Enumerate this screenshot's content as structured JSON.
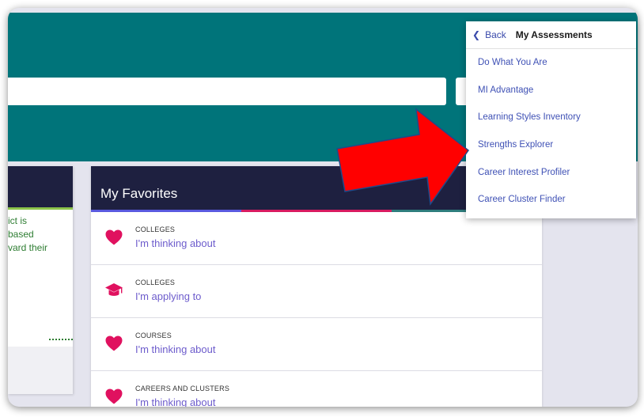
{
  "colors": {
    "teal_header": "#00747a",
    "dark_card_header": "#1e2040",
    "link_purple": "#6d5ccc",
    "dropdown_link": "#3f51b5",
    "heart": "#e0115f",
    "annotation_arrow": "#ff0000",
    "stripe": [
      "#5a5adf",
      "#d81b60",
      "#2e7d7d"
    ]
  },
  "left_card": {
    "text_lines": [
      "ict is",
      "based",
      "vard their"
    ]
  },
  "favorites": {
    "title": "My Favorites",
    "rows": [
      {
        "icon": "heart-icon",
        "category": "COLLEGES",
        "label": "I'm thinking about"
      },
      {
        "icon": "graduation-cap-icon",
        "category": "COLLEGES",
        "label": "I'm applying to"
      },
      {
        "icon": "heart-icon",
        "category": "COURSES",
        "label": "I'm thinking about"
      },
      {
        "icon": "heart-icon",
        "category": "CAREERS AND CLUSTERS",
        "label": "I'm thinking about"
      }
    ]
  },
  "dropdown": {
    "back_label": "Back",
    "title": "My Assessments",
    "items": [
      "Do What You Are",
      "MI Advantage",
      "Learning Styles Inventory",
      "Strengths Explorer",
      "Career Interest Profiler",
      "Career Cluster Finder"
    ]
  }
}
